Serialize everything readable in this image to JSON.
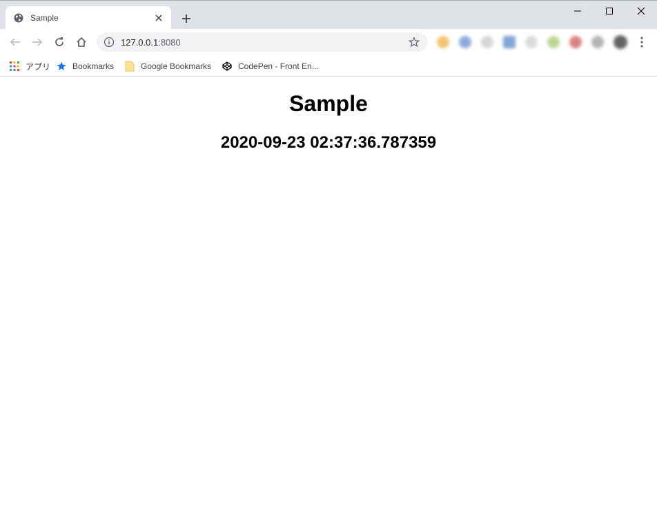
{
  "browser": {
    "tab": {
      "title": "Sample",
      "favicon": "globe-icon"
    },
    "new_tab_icon": "plus-icon",
    "window_controls": [
      "minimize-icon",
      "maximize-icon",
      "close-icon"
    ],
    "omnibox": {
      "host": "127.0.0.1",
      "port": ":8080"
    },
    "extensions_count": 9,
    "extension_colors": [
      "#f0b040",
      "#6a8fd0",
      "#c8c8c8",
      "#5a88c8",
      "#d0d0d0",
      "#a8c870",
      "#d05858",
      "#9a9a9a",
      "#303030"
    ]
  },
  "bookmarks": {
    "items": [
      {
        "label": "アプリ",
        "icon": "apps-grid-icon"
      },
      {
        "label": "Bookmarks",
        "icon": "star-icon"
      },
      {
        "label": "Google Bookmarks",
        "icon": "folder-icon"
      },
      {
        "label": "CodePen - Front En...",
        "icon": "codepen-icon"
      }
    ]
  },
  "page": {
    "heading": "Sample",
    "timestamp": "2020-09-23 02:37:36.787359"
  }
}
